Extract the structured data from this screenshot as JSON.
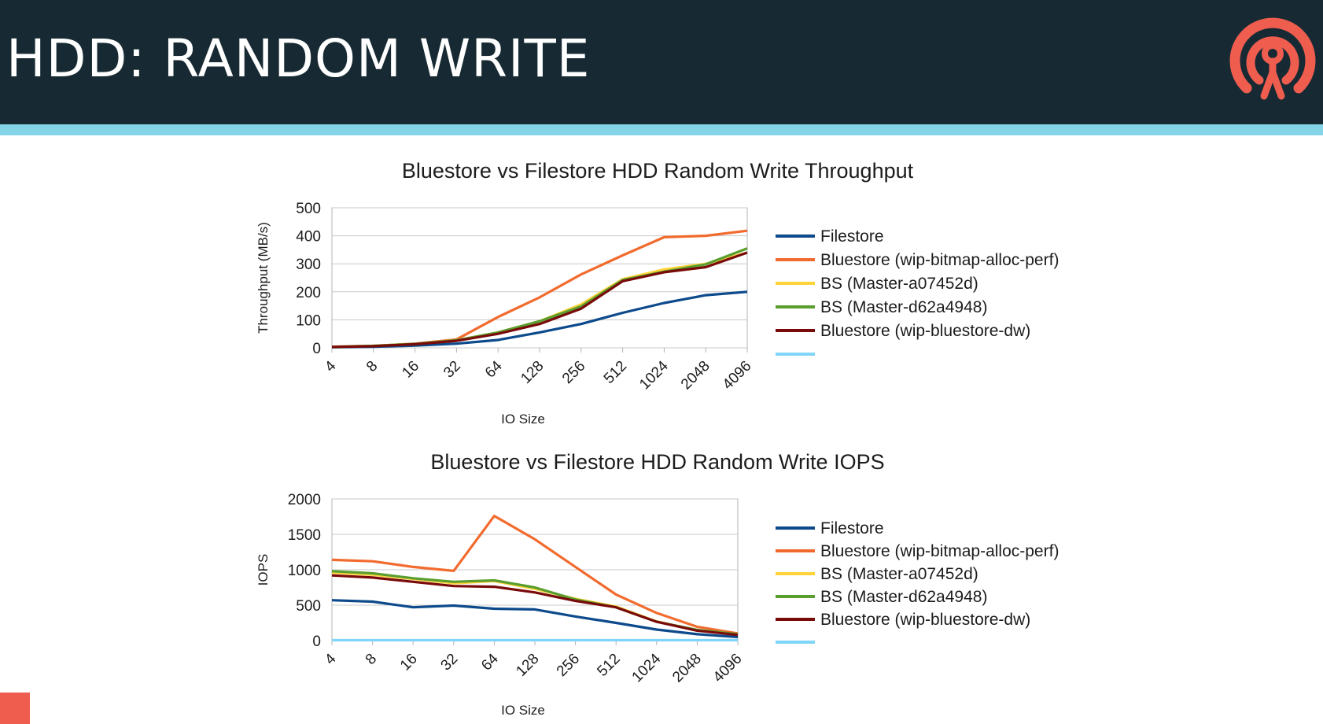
{
  "slide": {
    "title": "HDD: RANDOM WRITE",
    "header_color": "#172a33",
    "stripe_color": "#82d4e6",
    "logo_icon": "ceph-logo-icon",
    "logo_color": "#ef5d4f"
  },
  "chart_data": [
    {
      "type": "line",
      "title": "Bluestore vs Filestore HDD Random Write Throughput",
      "xlabel": "IO Size",
      "ylabel": "Throughput (MB/s)",
      "ylim": [
        0,
        500
      ],
      "yticks": [
        0,
        100,
        200,
        300,
        400,
        500
      ],
      "grid": "horizontal",
      "legend_position": "right",
      "categories": [
        "4",
        "8",
        "16",
        "32",
        "64",
        "128",
        "256",
        "512",
        "1024",
        "2048",
        "4096"
      ],
      "series": [
        {
          "name": "Filestore",
          "color": "#0d4a8c",
          "values": [
            2,
            4,
            8,
            15,
            28,
            55,
            85,
            125,
            160,
            188,
            200
          ]
        },
        {
          "name": "Bluestore (wip-bitmap-alloc-perf)",
          "color": "#f26b2e",
          "values": [
            4,
            7,
            15,
            30,
            110,
            180,
            262,
            330,
            395,
            400,
            418
          ]
        },
        {
          "name": "BS (Master-a07452d)",
          "color": "#ffd43b",
          "values": [
            3,
            7,
            14,
            27,
            55,
            95,
            155,
            245,
            280,
            300,
            340
          ]
        },
        {
          "name": "BS (Master-d62a4948)",
          "color": "#5a9e2f",
          "values": [
            3,
            7,
            14,
            27,
            55,
            95,
            148,
            242,
            272,
            298,
            355
          ]
        },
        {
          "name": "Bluestore (wip-bluestore-dw)",
          "color": "#7a0a0a",
          "values": [
            3,
            6,
            13,
            25,
            50,
            85,
            140,
            238,
            270,
            288,
            340
          ]
        },
        {
          "name": "",
          "color": "#81d4fa",
          "values": []
        }
      ]
    },
    {
      "type": "line",
      "title": "Bluestore vs Filestore HDD Random Write IOPS",
      "xlabel": "IO Size",
      "ylabel": "IOPS",
      "ylim": [
        0,
        2000
      ],
      "yticks": [
        0,
        500,
        1000,
        1500,
        2000
      ],
      "grid": "horizontal",
      "legend_position": "right",
      "categories": [
        "4",
        "8",
        "16",
        "32",
        "64",
        "128",
        "256",
        "512",
        "1024",
        "2048",
        "4096"
      ],
      "series": [
        {
          "name": "Filestore",
          "color": "#0d4a8c",
          "values": [
            570,
            550,
            470,
            495,
            450,
            440,
            340,
            250,
            155,
            90,
            50
          ]
        },
        {
          "name": "Bluestore (wip-bitmap-alloc-perf)",
          "color": "#f26b2e",
          "values": [
            1140,
            1120,
            1040,
            985,
            1760,
            1430,
            1040,
            650,
            390,
            195,
            100
          ]
        },
        {
          "name": "BS (Master-a07452d)",
          "color": "#ffd43b",
          "values": [
            960,
            930,
            870,
            810,
            840,
            730,
            590,
            480,
            270,
            145,
            85
          ]
        },
        {
          "name": "BS (Master-d62a4948)",
          "color": "#5a9e2f",
          "values": [
            980,
            950,
            880,
            830,
            850,
            750,
            580,
            470,
            265,
            150,
            90
          ]
        },
        {
          "name": "Bluestore (wip-bluestore-dw)",
          "color": "#7a0a0a",
          "values": [
            920,
            890,
            830,
            770,
            760,
            680,
            560,
            470,
            265,
            140,
            80
          ]
        },
        {
          "name": "",
          "color": "#81d4fa",
          "values": [
            5,
            5,
            5,
            5,
            5,
            5,
            5,
            5,
            5,
            5,
            5
          ]
        }
      ]
    }
  ]
}
